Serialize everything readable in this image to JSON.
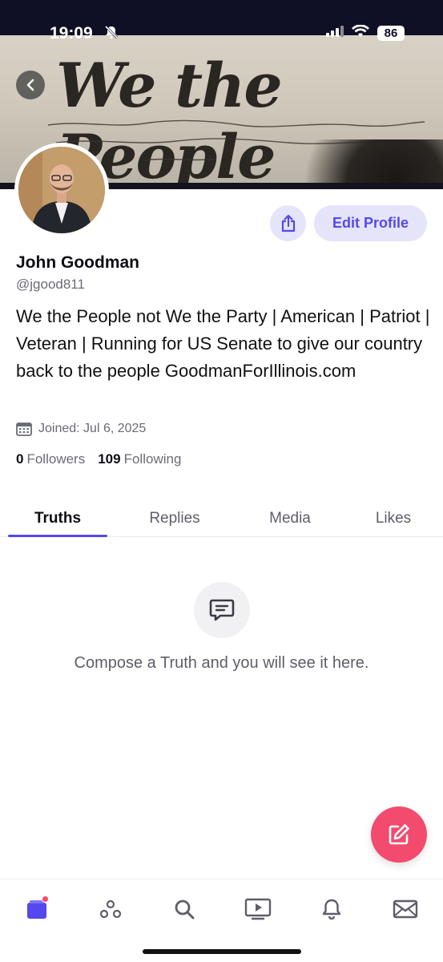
{
  "status_bar": {
    "time": "19:09",
    "battery": "86"
  },
  "banner": {
    "script_text": "We the People"
  },
  "profile": {
    "name": "John Goodman",
    "handle": "@jgood811",
    "bio": "We the People not We the Party | American | Patriot | Veteran | Running for US Senate to give our country back to the people GoodmanForIllinois.com",
    "joined": "Joined: Jul 6, 2025",
    "followers_count": "0",
    "followers_label": "Followers",
    "following_count": "109",
    "following_label": "Following"
  },
  "actions": {
    "edit_profile_label": "Edit Profile"
  },
  "tabs": [
    {
      "label": "Truths",
      "active": true
    },
    {
      "label": "Replies",
      "active": false
    },
    {
      "label": "Media",
      "active": false
    },
    {
      "label": "Likes",
      "active": false
    }
  ],
  "empty_state": {
    "message": "Compose a Truth and you will see it here.",
    "icon": "chat-bubble-icon"
  },
  "bottom_nav": [
    {
      "icon": "feed-icon",
      "active": true,
      "has_badge": true
    },
    {
      "icon": "groups-icon",
      "active": false
    },
    {
      "icon": "search-icon",
      "active": false
    },
    {
      "icon": "video-icon",
      "active": false
    },
    {
      "icon": "bell-icon",
      "active": false
    },
    {
      "icon": "mail-icon",
      "active": false
    }
  ],
  "colors": {
    "accent": "#5448ee",
    "fab": "#f24b6d",
    "badge": "#f24b6d",
    "status_bar": "#0f1026"
  }
}
